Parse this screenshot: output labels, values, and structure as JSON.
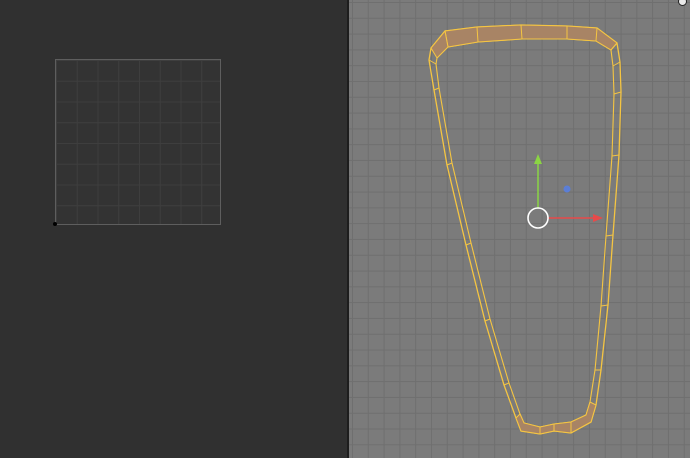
{
  "uv_editor": {
    "grid_color": "#5e5e5e",
    "background_color": "#303030"
  },
  "viewport": {
    "background_color": "#7b7b7b",
    "selection_color": "#f5c542",
    "face_fill_color": "#a88465",
    "gizmo": {
      "x_axis_color": "#e84a4a",
      "y_axis_color": "#8bd444",
      "z_axis_color": "#5b7ed6",
      "center_color": "#ffffff"
    }
  },
  "icons": {
    "corner_widget": "circle-dot-icon",
    "transform_gizmo": "move-gizmo-icon"
  }
}
